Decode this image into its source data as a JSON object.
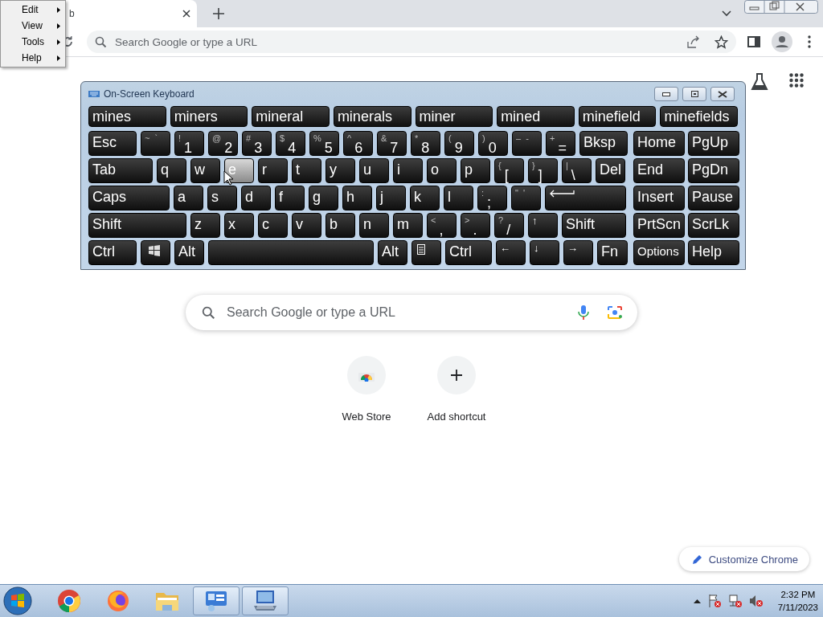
{
  "browser": {
    "tab": {
      "title": "b",
      "selected": true
    },
    "omnibox": {
      "placeholder": "Search Google or type a URL"
    }
  },
  "context_menu": {
    "items": [
      {
        "label": "Edit"
      },
      {
        "label": "View"
      },
      {
        "label": "Tools"
      },
      {
        "label": "Help"
      }
    ]
  },
  "new_tab_page": {
    "search": {
      "placeholder": "Search Google or type a URL"
    },
    "shortcuts": [
      {
        "kind": "store",
        "label": "Web Store"
      },
      {
        "kind": "add",
        "label": "Add shortcut"
      }
    ],
    "customize_button": "Customize Chrome"
  },
  "keyboard": {
    "title": "On-Screen Keyboard",
    "suggestions": [
      "mines",
      "miners",
      "mineral",
      "minerals",
      "miner",
      "mined",
      "minefield",
      "minefields"
    ],
    "rows": [
      {
        "keys": [
          {
            "kind": "text",
            "label": "Esc",
            "hovered": false
          },
          {
            "kind": "pair",
            "shift": "~",
            "label": "`",
            "hovered": false
          },
          {
            "kind": "dual",
            "shift": "!",
            "label": "1",
            "hovered": false
          },
          {
            "kind": "dual",
            "shift": "@",
            "label": "2",
            "hovered": false
          },
          {
            "kind": "dual",
            "shift": "#",
            "label": "3",
            "hovered": false
          },
          {
            "kind": "dual",
            "shift": "$",
            "label": "4",
            "hovered": false
          },
          {
            "kind": "dual",
            "shift": "%",
            "label": "5",
            "hovered": false
          },
          {
            "kind": "dual",
            "shift": "^",
            "label": "6",
            "hovered": false
          },
          {
            "kind": "dual",
            "shift": "&",
            "label": "7",
            "hovered": false
          },
          {
            "kind": "dual",
            "shift": "*",
            "label": "8",
            "hovered": false
          },
          {
            "kind": "dual",
            "shift": "(",
            "label": "9",
            "hovered": false
          },
          {
            "kind": "dual",
            "shift": ")",
            "label": "0",
            "hovered": false
          },
          {
            "kind": "pair",
            "shift": "–",
            "label": "-",
            "hovered": false
          },
          {
            "kind": "dual",
            "shift": "+",
            "label": "=",
            "hovered": false
          },
          {
            "kind": "text",
            "label": "Bksp",
            "hovered": false
          }
        ]
      },
      {
        "keys": [
          {
            "kind": "text",
            "label": "Tab",
            "hovered": false
          },
          {
            "kind": "text",
            "label": "q",
            "hovered": false
          },
          {
            "kind": "text",
            "label": "w",
            "hovered": false
          },
          {
            "kind": "text",
            "label": "e",
            "hovered": true
          },
          {
            "kind": "text",
            "label": "r",
            "hovered": false
          },
          {
            "kind": "text",
            "label": "t",
            "hovered": false
          },
          {
            "kind": "text",
            "label": "y",
            "hovered": false
          },
          {
            "kind": "text",
            "label": "u",
            "hovered": false
          },
          {
            "kind": "text",
            "label": "i",
            "hovered": false
          },
          {
            "kind": "text",
            "label": "o",
            "hovered": false
          },
          {
            "kind": "text",
            "label": "p",
            "hovered": false
          },
          {
            "kind": "dual",
            "shift": "{",
            "label": "[",
            "hovered": false
          },
          {
            "kind": "dual",
            "shift": "}",
            "label": "]",
            "hovered": false
          },
          {
            "kind": "dual",
            "shift": "|",
            "label": "\\",
            "hovered": false
          },
          {
            "kind": "text",
            "label": "Del",
            "hovered": false
          }
        ]
      },
      {
        "keys": [
          {
            "kind": "text",
            "label": "Caps",
            "hovered": false
          },
          {
            "kind": "text",
            "label": "a",
            "hovered": false
          },
          {
            "kind": "text",
            "label": "s",
            "hovered": false
          },
          {
            "kind": "text",
            "label": "d",
            "hovered": false
          },
          {
            "kind": "text",
            "label": "f",
            "hovered": false
          },
          {
            "kind": "text",
            "label": "g",
            "hovered": false
          },
          {
            "kind": "text",
            "label": "h",
            "hovered": false
          },
          {
            "kind": "text",
            "label": "j",
            "hovered": false
          },
          {
            "kind": "text",
            "label": "k",
            "hovered": false
          },
          {
            "kind": "text",
            "label": "l",
            "hovered": false
          },
          {
            "kind": "dual",
            "shift": ":",
            "label": ";",
            "hovered": false
          },
          {
            "kind": "pair",
            "shift": "\"",
            "label": "'",
            "hovered": false
          },
          {
            "kind": "enter",
            "hovered": false
          }
        ]
      },
      {
        "keys": [
          {
            "kind": "text",
            "label": "Shift",
            "hovered": false
          },
          {
            "kind": "text",
            "label": "z",
            "hovered": false
          },
          {
            "kind": "text",
            "label": "x",
            "hovered": false
          },
          {
            "kind": "text",
            "label": "c",
            "hovered": false
          },
          {
            "kind": "text",
            "label": "v",
            "hovered": false
          },
          {
            "kind": "text",
            "label": "b",
            "hovered": false
          },
          {
            "kind": "text",
            "label": "n",
            "hovered": false
          },
          {
            "kind": "text",
            "label": "m",
            "hovered": false
          },
          {
            "kind": "dual",
            "shift": "<",
            "label": ",",
            "hovered": false
          },
          {
            "kind": "dual",
            "shift": ">",
            "label": ".",
            "hovered": false
          },
          {
            "kind": "dual",
            "shift": "?",
            "label": "/",
            "hovered": false
          },
          {
            "kind": "arrow",
            "label": "↑",
            "hovered": false
          },
          {
            "kind": "text",
            "label": "Shift",
            "hovered": false
          }
        ]
      },
      {
        "keys": [
          {
            "kind": "text",
            "label": "Ctrl",
            "hovered": false
          },
          {
            "kind": "windows",
            "hovered": false
          },
          {
            "kind": "text",
            "label": "Alt",
            "hovered": false
          },
          {
            "kind": "space",
            "hovered": false
          },
          {
            "kind": "text",
            "label": "Alt",
            "hovered": false
          },
          {
            "kind": "menu",
            "hovered": false
          },
          {
            "kind": "text",
            "label": "Ctrl",
            "hovered": false
          },
          {
            "kind": "arrow",
            "label": "←",
            "hovered": false
          },
          {
            "kind": "arrow",
            "label": "↓",
            "hovered": false
          },
          {
            "kind": "arrow",
            "label": "→",
            "hovered": false
          },
          {
            "kind": "text",
            "label": "Fn",
            "hovered": false
          }
        ]
      }
    ],
    "nav_rows": [
      {
        "keys": [
          {
            "kind": "text",
            "label": "Home",
            "hovered": false
          },
          {
            "kind": "text",
            "label": "PgUp",
            "hovered": false
          }
        ]
      },
      {
        "keys": [
          {
            "kind": "text",
            "label": "End",
            "hovered": false
          },
          {
            "kind": "text",
            "label": "PgDn",
            "hovered": false
          }
        ]
      },
      {
        "keys": [
          {
            "kind": "text",
            "label": "Insert",
            "hovered": false
          },
          {
            "kind": "text",
            "label": "Pause",
            "hovered": false
          }
        ]
      },
      {
        "keys": [
          {
            "kind": "text",
            "label": "PrtScn",
            "hovered": false
          },
          {
            "kind": "text",
            "label": "ScrLk",
            "hovered": false
          }
        ]
      },
      {
        "keys": [
          {
            "kind": "compact",
            "label": "Options",
            "hovered": false
          },
          {
            "kind": "text",
            "label": "Help",
            "hovered": false
          }
        ]
      }
    ]
  },
  "taskbar": {
    "apps": [
      {
        "kind": "chrome",
        "selected": false
      },
      {
        "kind": "firefox",
        "selected": false
      },
      {
        "kind": "folder",
        "selected": false
      },
      {
        "kind": "control-panel",
        "selected": true
      },
      {
        "kind": "keyboard",
        "selected": true
      }
    ],
    "time": "2:32 PM",
    "date": "7/11/2023"
  }
}
